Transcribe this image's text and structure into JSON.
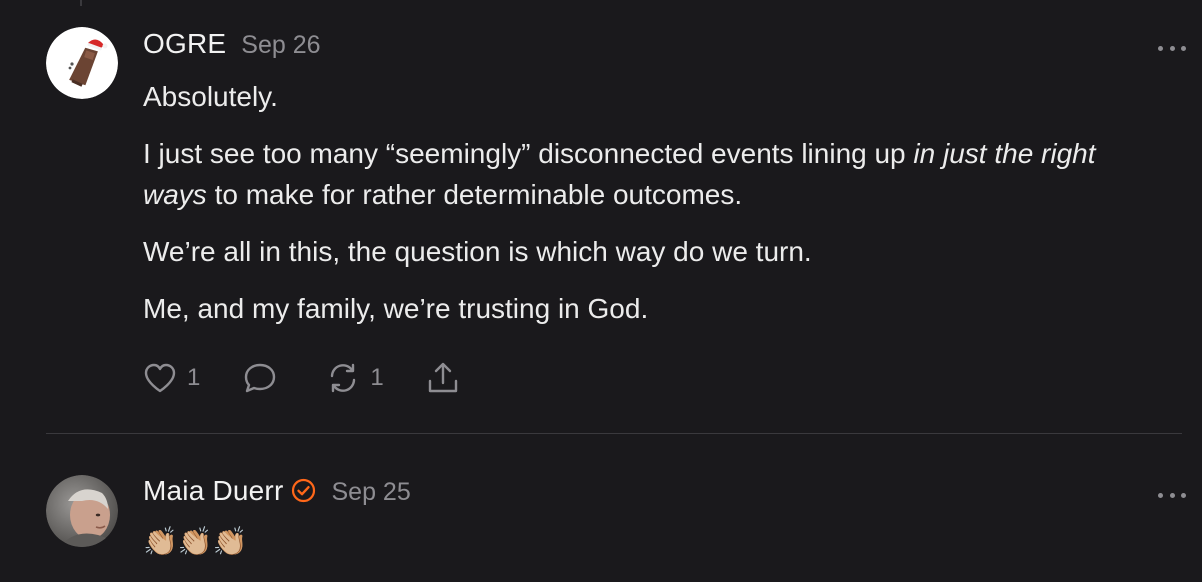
{
  "comments": [
    {
      "author": "OGRE",
      "date": "Sep 26",
      "avatar_icon": "ogre-avatar-icon",
      "paragraphs": [
        "Absolutely.",
        "We’re all in this, the question is which way do we turn.",
        "Me, and my family, we’re trusting in God."
      ],
      "p2_before": "I just see too many “seemingly” disconnected events lining up ",
      "p2_italic": "in just the right ways",
      "p2_after": " to make for rather determinable outcomes.",
      "likes": "1",
      "restacks": "1"
    },
    {
      "author": "Maia Duerr",
      "date": "Sep 25",
      "verified": true,
      "body": "👏🏼👏🏼👏🏼"
    }
  ],
  "colors": {
    "background": "#1a191c",
    "text": "#ececec",
    "muted": "#8e8d92",
    "verified_accent": "#ff6719"
  }
}
